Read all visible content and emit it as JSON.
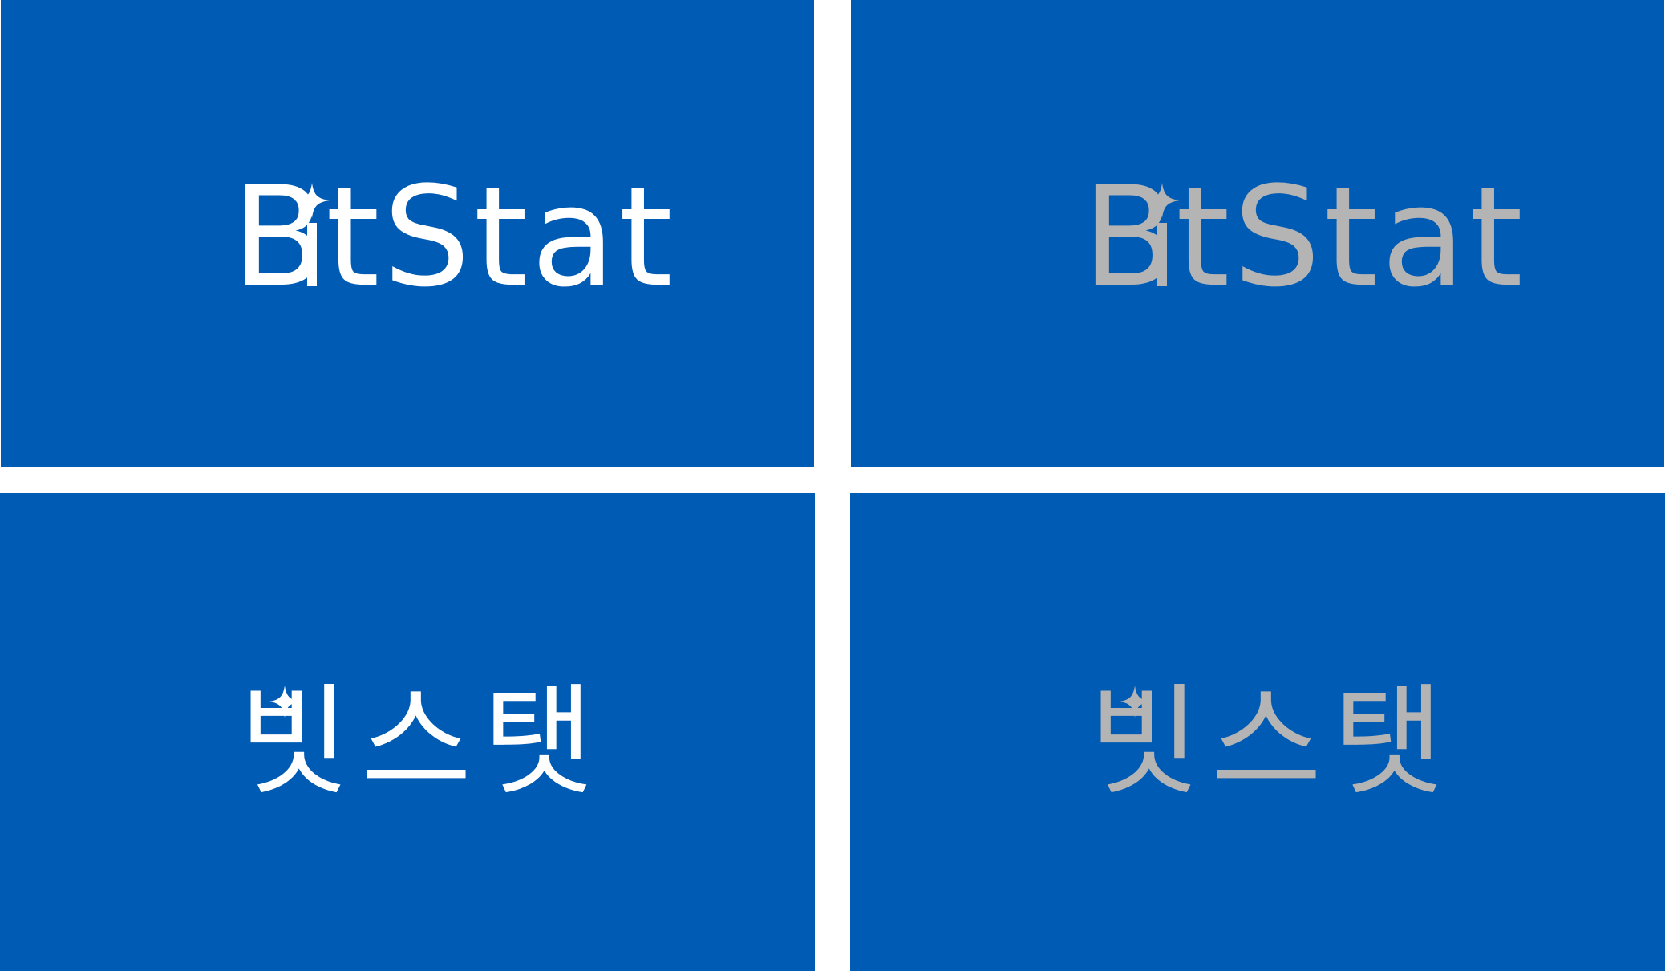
{
  "colors": {
    "background": "#005BB4",
    "separator": "#FFFFFF",
    "logo_white": "#FFFFFF",
    "logo_gray": "#B4B4B4"
  },
  "logos": {
    "en_white": {
      "text_first": "B",
      "text_rest": "tStat",
      "color_name": "white"
    },
    "en_gray": {
      "text_first": "B",
      "text_rest": "tStat",
      "color_name": "gray"
    },
    "ko_white": {
      "text": "빗스탯",
      "color_name": "white"
    },
    "ko_gray": {
      "text": "빗스탯",
      "color_name": "gray"
    }
  },
  "icons": {
    "sparkle": "sparkle-icon"
  }
}
